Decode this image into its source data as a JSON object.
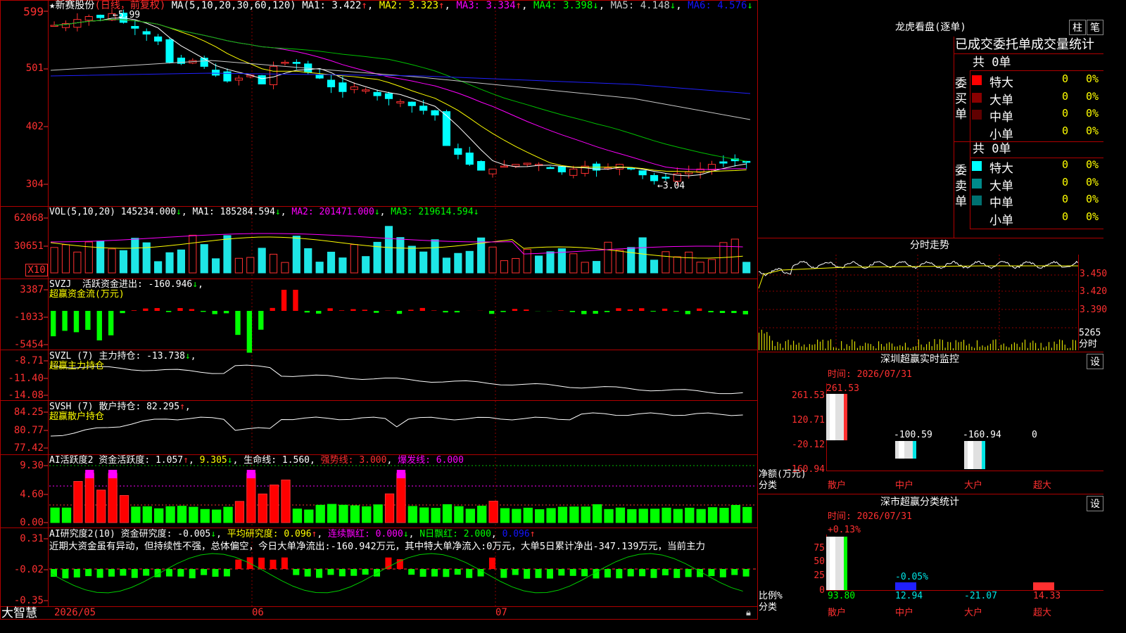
{
  "colors": {
    "up": "#ff3030",
    "down": "#00e6e6",
    "vol_down": "#1ee6e6",
    "bg": "#000000",
    "grid": "#8b0000"
  },
  "header": {
    "star": "★",
    "stock": "新赛股份",
    "period": "(日线，前复权)",
    "ma_label": "MA(5,10,20,30,60,120)",
    "ma1": "MA1: 3.422",
    "ma2": "MA2: 3.323",
    "ma3": "MA3: 3.334",
    "ma4": "MA4: 3.398",
    "ma5": "MA5: 4.148",
    "ma6": "MA6: 4.576",
    "high_mark": "5.99",
    "low_mark": "3.04"
  },
  "price_axis": [
    "599",
    "501",
    "402",
    "304"
  ],
  "vol": {
    "label": "VOL(5,10,20)",
    "v": "145234.000",
    "ma1": "MA1: 185284.594",
    "ma2": "MA2: 201471.000",
    "ma3": "MA3: 219614.594",
    "axis": [
      "62068",
      "30651"
    ],
    "unit": "X10"
  },
  "svzj": {
    "label": "SVZJ",
    "title": "活跃资金进出: -160.946",
    "sub": "超赢资金流(万元)",
    "axis": [
      "3387",
      "-1033",
      "-5454"
    ]
  },
  "svzl": {
    "label": "SVZL (7)",
    "title": "主力持仓: -13.738",
    "sub": "超赢主力持仓",
    "axis": [
      "-8.71",
      "-11.40",
      "-14.08"
    ]
  },
  "svsh": {
    "label": "SVSH (7)",
    "title": "散户持仓: 82.295",
    "sub": "超赢散户持仓",
    "axis": [
      "84.25",
      "80.77",
      "77.42"
    ]
  },
  "ai1": {
    "label": "AI活跃度2",
    "v1": "资金活跃度: 1.057",
    "v2": "9.305",
    "v3": "生命线: 1.560",
    "v4": "强势线: 3.000",
    "v5": "爆发线: 6.000",
    "axis": [
      "9.30",
      "4.60",
      "0.00"
    ]
  },
  "ai2": {
    "label": "AI研究度2(10)",
    "v1": "资金研究度: -0.005",
    "v2": "平均研究度: 0.096",
    "v3": "连续飘红: 0.000",
    "v4": "N日飘红: 2.000",
    "v5": "0.096",
    "comment": "近期大资金虽有异动，但持续性不强，总体偏空，今日大单净流出:-160.942万元，其中特大单净流入:0万元，大单5日累计净出-347.139万元，当前主力",
    "axis": [
      "0.31",
      "-0.02",
      "-0.35"
    ]
  },
  "date_axis": [
    "2026/05",
    "06",
    "07"
  ],
  "brand": "大智慧",
  "right": {
    "title": "龙虎看盘(逐单)",
    "btn1": "柱",
    "btn2": "笔",
    "header": "已成交委托单成交量统计",
    "buy": {
      "side": "委买单",
      "total": "共 0单",
      "rows": [
        {
          "name": "特大",
          "v": "0",
          "p": "0%",
          "color": "#ff0000"
        },
        {
          "name": "大单",
          "v": "0",
          "p": "0%",
          "color": "#8b0000"
        },
        {
          "name": "中单",
          "v": "0",
          "p": "0%",
          "color": "#600000"
        },
        {
          "name": "小单",
          "v": "0",
          "p": "0%",
          "color": ""
        }
      ]
    },
    "sell": {
      "side": "委卖单",
      "total": "共 0单",
      "rows": [
        {
          "name": "特大",
          "v": "0",
          "p": "0%",
          "color": "#00ffff"
        },
        {
          "name": "大单",
          "v": "0",
          "p": "0%",
          "color": "#008b8b"
        },
        {
          "name": "中单",
          "v": "0",
          "p": "0%",
          "color": "#007070"
        },
        {
          "name": "小单",
          "v": "0",
          "p": "0%",
          "color": ""
        }
      ]
    },
    "intraday": {
      "title": "分时走势",
      "axis": [
        "3.450",
        "3.420",
        "3.390"
      ],
      "vol": "5265",
      "vol_unit": "分时"
    },
    "sz_monitor": {
      "title": "深圳超赢实时监控",
      "btn": "设",
      "time": "时间: 2026/07/31",
      "axis": [
        "261.53",
        "120.71",
        "-20.12",
        "-160.94"
      ],
      "unit": "净额(万元)",
      "cat_label": "分类",
      "bars": [
        {
          "name": "散户",
          "v": "261.53"
        },
        {
          "name": "中户",
          "v": "-100.59"
        },
        {
          "name": "大户",
          "v": "-160.94"
        },
        {
          "name": "超大",
          "v": "0"
        }
      ]
    },
    "sz_stats": {
      "title": "深市超赢分类统计",
      "btn": "设",
      "time": "时间: 2026/07/31",
      "top_pct": "+0.13%",
      "mid_pct": "-0.05%",
      "axis": [
        "75",
        "50",
        "25",
        "0"
      ],
      "unit": "比例%",
      "cat_label": "分类",
      "bars": [
        {
          "name": "散户",
          "v": "93.80"
        },
        {
          "name": "中户",
          "v": "12.94"
        },
        {
          "name": "大户",
          "v": "-21.07"
        },
        {
          "name": "超大",
          "v": "14.33"
        }
      ]
    }
  }
}
